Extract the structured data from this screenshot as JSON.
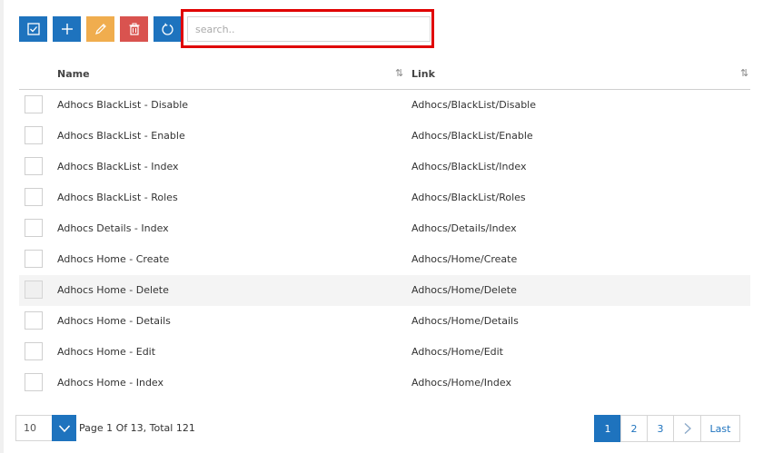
{
  "toolbar": {
    "buttons": [
      {
        "name": "select-all",
        "icon": "checkbox-icon",
        "color": "#1e73be"
      },
      {
        "name": "add",
        "icon": "plus-icon",
        "color": "#1e73be"
      },
      {
        "name": "edit",
        "icon": "pencil-icon",
        "color": "#f0ad4e"
      },
      {
        "name": "delete",
        "icon": "trash-icon",
        "color": "#d9534f"
      },
      {
        "name": "refresh",
        "icon": "refresh-icon",
        "color": "#1e73be"
      }
    ],
    "search": {
      "placeholder": "search..",
      "value": "",
      "highlight_color": "#e00000"
    }
  },
  "table": {
    "columns": [
      {
        "label": "Name",
        "sort_icon": "sort-icon"
      },
      {
        "label": "Link",
        "sort_icon": "sort-icon"
      }
    ],
    "rows": [
      {
        "name": "Adhocs BlackList - Disable",
        "link": "Adhocs/BlackList/Disable"
      },
      {
        "name": "Adhocs BlackList - Enable",
        "link": "Adhocs/BlackList/Enable"
      },
      {
        "name": "Adhocs BlackList - Index",
        "link": "Adhocs/BlackList/Index"
      },
      {
        "name": "Adhocs BlackList - Roles",
        "link": "Adhocs/BlackList/Roles"
      },
      {
        "name": "Adhocs Details - Index",
        "link": "Adhocs/Details/Index"
      },
      {
        "name": "Adhocs Home - Create",
        "link": "Adhocs/Home/Create"
      },
      {
        "name": "Adhocs Home - Delete",
        "link": "Adhocs/Home/Delete"
      },
      {
        "name": "Adhocs Home - Details",
        "link": "Adhocs/Home/Details"
      },
      {
        "name": "Adhocs Home - Edit",
        "link": "Adhocs/Home/Edit"
      },
      {
        "name": "Adhocs Home - Index",
        "link": "Adhocs/Home/Index"
      }
    ],
    "hovered_row_index": 6
  },
  "footer": {
    "page_size": "10",
    "page_info": "Page 1 Of 13, Total 121",
    "pages": [
      "1",
      "2",
      "3"
    ],
    "current_page": "1",
    "next_icon": "chevron-right-icon",
    "last_label": "Last",
    "accent": "#1e73be"
  }
}
